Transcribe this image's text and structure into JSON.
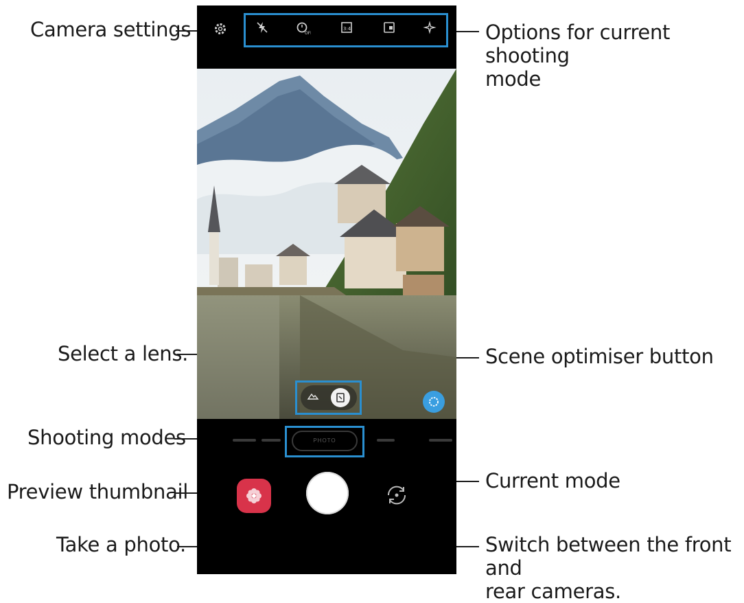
{
  "callouts": {
    "camera_settings": "Camera settings",
    "options_line1": "Options for current shooting",
    "options_line2": "mode",
    "select_lens": "Select a lens.",
    "scene_optimiser": "Scene optimiser button",
    "shooting_modes": "Shooting modes",
    "current_mode": "Current mode",
    "preview_thumbnail": "Preview thumbnail",
    "take_photo": "Take a photo.",
    "switch_line1": "Switch between the front and",
    "switch_line2": "rear cameras."
  },
  "topbar": {
    "icons": [
      "gear-icon",
      "flash-off-icon",
      "timer-off-icon",
      "aspect-ratio-icon",
      "motion-photo-icon",
      "filter-icon"
    ]
  },
  "modes": {
    "current": "PHOTO"
  },
  "colors": {
    "highlight": "#2a8fd0",
    "thumbnail": "#d8334a",
    "scene_button": "#3a9ee0"
  }
}
